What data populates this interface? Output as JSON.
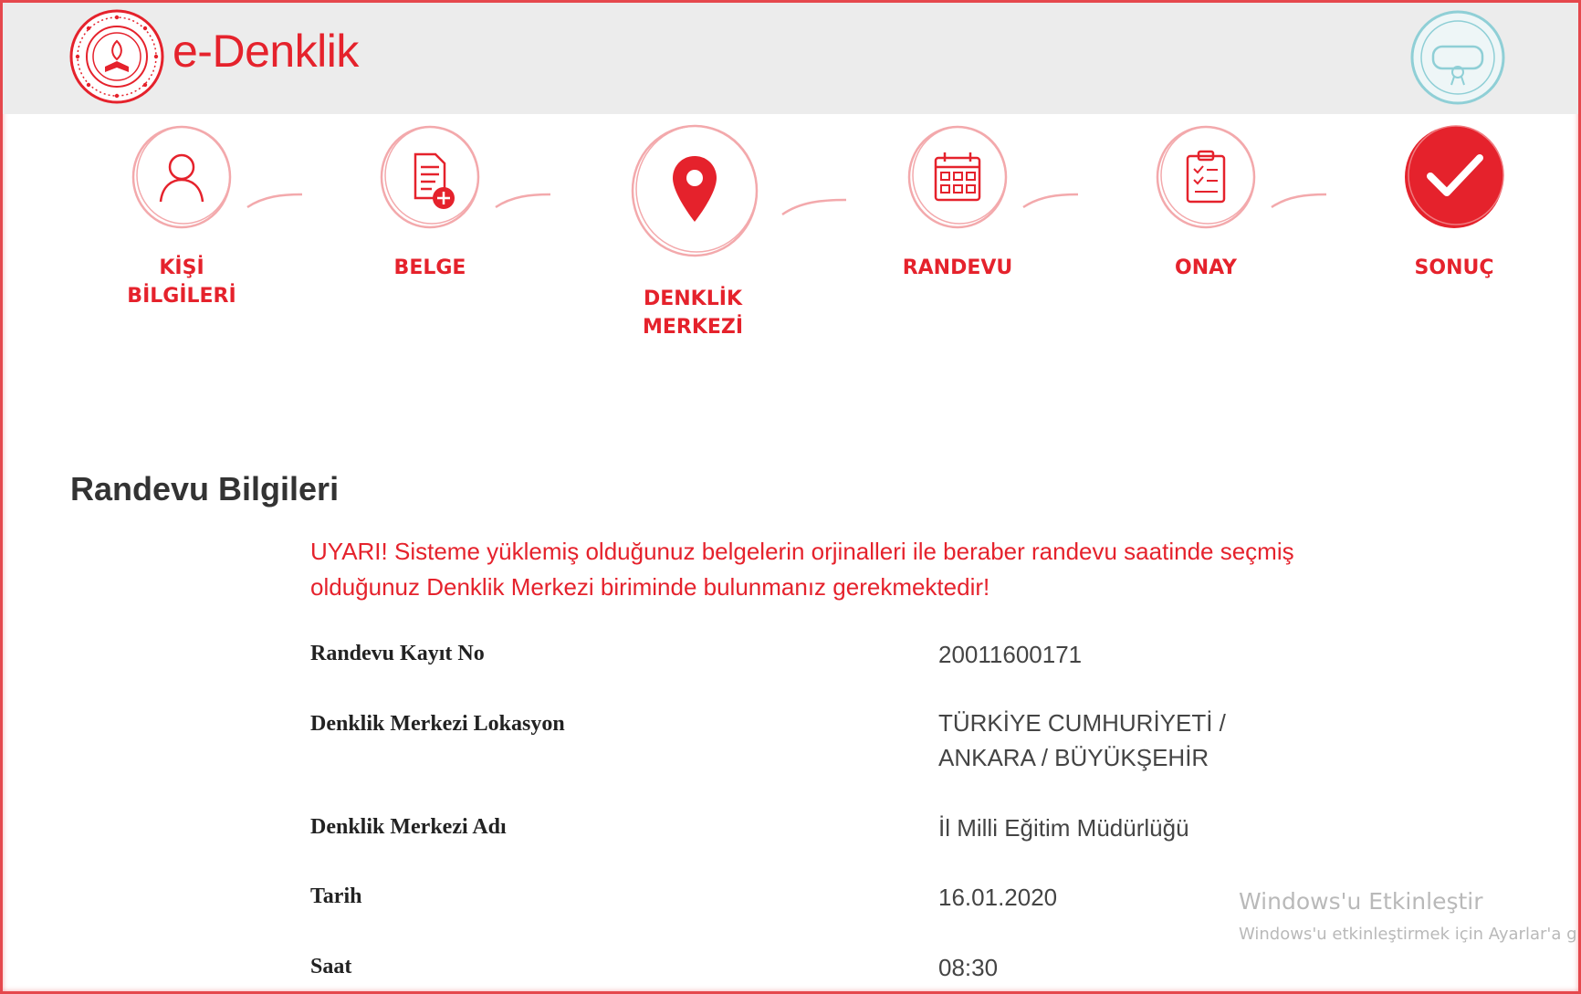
{
  "app": {
    "brand": "e-Denklik",
    "accent_color": "#e5222c",
    "logo_icon": "ministry-emblem-icon",
    "seal_icon": "diploma-seal-icon"
  },
  "steps": [
    {
      "label": "KİŞİ\nBİLGİLERİ",
      "icon": "user-icon",
      "state": "inactive"
    },
    {
      "label": "BELGE",
      "icon": "document-add-icon",
      "state": "inactive"
    },
    {
      "label": "DENKLİK\nMERKEZİ",
      "icon": "location-pin-icon",
      "state": "inactive"
    },
    {
      "label": "RANDEVU",
      "icon": "calendar-icon",
      "state": "inactive"
    },
    {
      "label": "ONAY",
      "icon": "clipboard-icon",
      "state": "inactive"
    },
    {
      "label": "SONUÇ",
      "icon": "checkmark-icon",
      "state": "active"
    }
  ],
  "section": {
    "title": "Randevu Bilgileri",
    "warning": "UYARI! Sisteme yüklemiş olduğunuz belgelerin orjinalleri ile beraber randevu saatinde seçmiş olduğunuz Denklik Merkezi biriminde bulunmanız gerekmektedir!"
  },
  "details": [
    {
      "label": "Randevu Kayıt No",
      "value": "20011600171"
    },
    {
      "label": "Denklik Merkezi Lokasyon",
      "value": "TÜRKİYE CUMHURİYETİ / ANKARA / BÜYÜKŞEHİR"
    },
    {
      "label": "Denklik Merkezi Adı",
      "value": "İl Milli Eğitim Müdürlüğü"
    },
    {
      "label": "Tarih",
      "value": "16.01.2020"
    },
    {
      "label": "Saat",
      "value": "08:30"
    }
  ],
  "watermark": {
    "title": "Windows'u Etkinleştir",
    "subtitle": "Windows'u etkinleştirmek için Ayarlar'a gi"
  }
}
